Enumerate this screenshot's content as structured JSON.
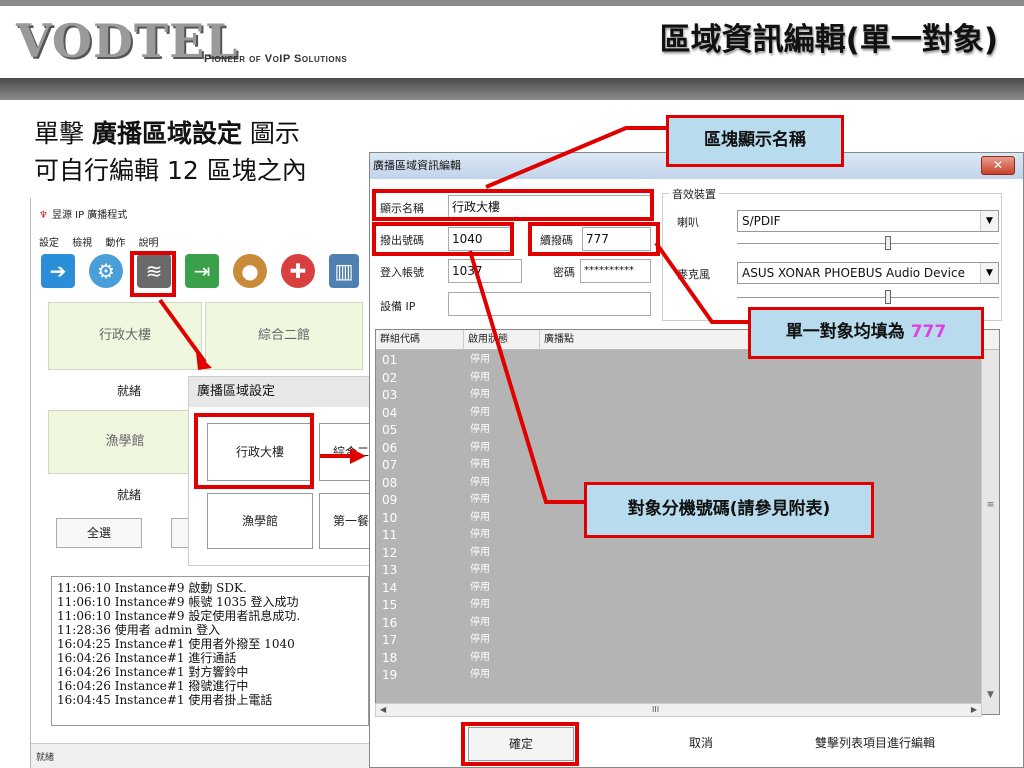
{
  "header": {
    "logo": "VODTEL",
    "tagline": "Pioneer of VoIP Solutions",
    "title": "區域資訊編輯(單一對象)"
  },
  "intro": {
    "line1_pre": "單擊 ",
    "line1_bold": "廣播區域設定",
    "line1_post": " 圖示",
    "line2": "可自行編輯 12 區塊之內"
  },
  "program": {
    "title": "昱源 IP 廣播程式",
    "menu": [
      "設定",
      "檢視",
      "動作",
      "說明"
    ],
    "toolbar_icons": [
      "exit-icon",
      "settings-gear-icon",
      "wifi-zone-icon",
      "transfer-icon",
      "user-icon",
      "pin-icon",
      "book-icon"
    ],
    "zones_top": [
      "行政大樓",
      "綜合二館"
    ],
    "zone_mid": "漁學館",
    "ready": "就緒",
    "select_all": "全選",
    "log": [
      "11:06:10 Instance#9 啟動 SDK.",
      "11:06:10 Instance#9 帳號 1035 登入成功",
      "11:06:10 Instance#9 設定使用者訊息成功.",
      "11:28:36 使用者 admin 登入",
      "16:04:25 Instance#1 使用者外撥至 1040",
      "16:04:26 Instance#1 進行通話",
      "16:04:26 Instance#1 對方響鈴中",
      "16:04:26 Instance#1 撥號進行中",
      "16:04:45 Instance#1 使用者掛上電話"
    ],
    "status": "就緒"
  },
  "popup": {
    "title": "廣播區域設定",
    "btn_selected": "行政大樓",
    "btn_2": "綜合二",
    "btn_3": "漁學館",
    "btn_4": "第一餐"
  },
  "dialog": {
    "title": "廣播區域資訊編輯",
    "close": "✕",
    "display_name_label": "顯示名稱",
    "display_name": "行政大樓",
    "dial_out_label": "撥出號碼",
    "dial_out": "1040",
    "continue_label": "續撥碼",
    "continue_code": "777",
    "login_label": "登入帳號",
    "login": "1037",
    "password_label": "密碼",
    "password": "**********",
    "device_ip_label": "設備 IP",
    "device_ip": "",
    "audio_group": "音效裝置",
    "speaker_label": "喇叭",
    "speaker": "S/PDIF",
    "mic_label": "麥克風",
    "mic": "ASUS XONAR PHOEBUS Audio Device",
    "grid_headers": [
      "群組代碼",
      "啟用狀態",
      "廣播點"
    ],
    "rows": [
      [
        "01",
        "停用"
      ],
      [
        "02",
        "停用"
      ],
      [
        "03",
        "停用"
      ],
      [
        "04",
        "停用"
      ],
      [
        "05",
        "停用"
      ],
      [
        "06",
        "停用"
      ],
      [
        "07",
        "停用"
      ],
      [
        "08",
        "停用"
      ],
      [
        "09",
        "停用"
      ],
      [
        "10",
        "停用"
      ],
      [
        "11",
        "停用"
      ],
      [
        "12",
        "停用"
      ],
      [
        "13",
        "停用"
      ],
      [
        "14",
        "停用"
      ],
      [
        "15",
        "停用"
      ],
      [
        "16",
        "停用"
      ],
      [
        "17",
        "停用"
      ],
      [
        "18",
        "停用"
      ],
      [
        "19",
        "停用"
      ]
    ],
    "ok": "確定",
    "cancel": "取消",
    "hint": "雙擊列表項目進行編輯",
    "hscroll_mark": "III"
  },
  "callouts": {
    "name": "區塊顯示名稱",
    "single_pre": "單一對象均填為 ",
    "single_val": "777",
    "ext": "對象分機號碼(請參見附表)"
  },
  "colors": {
    "accent_red": "#e00000",
    "callout_bg": "#b8dcee",
    "highlight": "#e040e0"
  }
}
